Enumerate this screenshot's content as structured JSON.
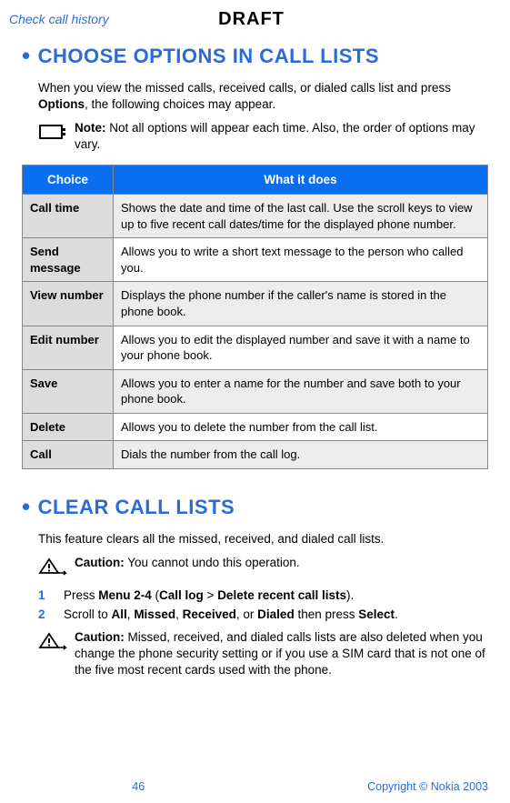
{
  "header": {
    "left": "Check call history",
    "center": "DRAFT"
  },
  "section1": {
    "title": "CHOOSE OPTIONS IN CALL LISTS",
    "intro_pre": "When you view the missed calls, received calls, or dialed calls list and press ",
    "intro_bold": "Options",
    "intro_post": ", the following choices may appear.",
    "note_label": "Note:",
    "note_body": " Not all options will appear each time. Also, the order of options may vary."
  },
  "table": {
    "headers": {
      "choice": "Choice",
      "desc": "What it does"
    },
    "rows": [
      {
        "choice": "Call time",
        "desc": "Shows the date and time of the last call. Use the scroll keys to view up to five recent call dates/time for the displayed phone number."
      },
      {
        "choice": "Send message",
        "desc": "Allows you to write a short text message to the person who called you."
      },
      {
        "choice": "View number",
        "desc": "Displays the phone number if the caller's name is stored in the phone book."
      },
      {
        "choice": "Edit number",
        "desc": "Allows you to edit the displayed number and save it with a name to your phone book."
      },
      {
        "choice": "Save",
        "desc": "Allows you to enter a name for the number and save both to your phone book."
      },
      {
        "choice": "Delete",
        "desc": "Allows you to delete the number from the call list."
      },
      {
        "choice": "Call",
        "desc": "Dials the number from the call log."
      }
    ]
  },
  "section2": {
    "title": "CLEAR CALL LISTS",
    "intro": "This feature clears all the missed, received, and dialed call lists.",
    "caution1_label": "Caution:",
    "caution1_body": " You cannot undo this operation.",
    "step1_num": "1",
    "step1_a": "Press ",
    "step1_b": "Menu 2-4",
    "step1_c": " (",
    "step1_d": "Call log",
    "step1_e": " > ",
    "step1_f": "Delete recent call lists",
    "step1_g": ").",
    "step2_num": "2",
    "step2_a": "Scroll to ",
    "step2_b": "All",
    "step2_c": ", ",
    "step2_d": "Missed",
    "step2_e": ", ",
    "step2_f": "Received",
    "step2_g": ", or ",
    "step2_h": "Dialed",
    "step2_i": " then press ",
    "step2_j": "Select",
    "step2_k": ".",
    "caution2_label": "Caution:",
    "caution2_body": " Missed, received, and dialed calls lists are also deleted when you change the phone security setting or if you use a SIM card that is not one of the five most recent cards used with the phone."
  },
  "footer": {
    "page": "46",
    "copyright": "Copyright © Nokia 2003"
  }
}
